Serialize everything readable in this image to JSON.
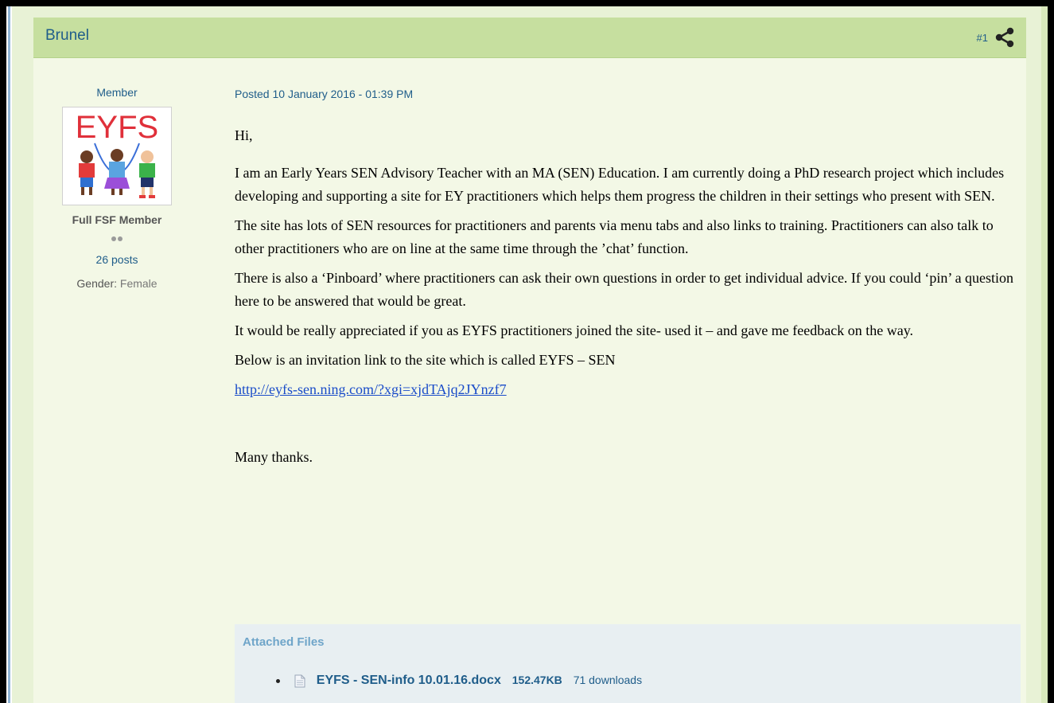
{
  "post": {
    "author": "Brunel",
    "number": "#1",
    "member_title": "Member",
    "avatar_text": "EYFS",
    "rank": "Full FSF Member",
    "post_count": "26 posts",
    "gender_label": "Gender:",
    "gender_value": "Female",
    "date": "Posted 10 January 2016 - 01:39 PM",
    "greeting": "Hi,",
    "paragraphs": [
      "I am an Early Years SEN Advisory Teacher with an MA (SEN) Education. I am currently doing a PhD research project which includes developing and supporting a site for EY practitioners which helps them progress the children in their settings who present with SEN.",
      "The site has lots of SEN resources for practitioners and parents via menu tabs and also links to training. Practitioners can also talk to other practitioners who are on line at the same time through the ’chat’ function.",
      "There is also a ‘Pinboard’ where practitioners can ask their own questions in order to get individual advice.  If you could ‘pin’ a question here to be answered that would be great.",
      "It would be really appreciated if you as EYFS practitioners joined the site- used it – and gave me feedback on the way.",
      "Below is an invitation link to the site which is called EYFS – SEN"
    ],
    "link": "http://eyfs-sen.ning.com/?xgi=xjdTAjq2JYnzf7",
    "closing": "Many thanks.",
    "attachments": {
      "title": "Attached Files",
      "files": [
        {
          "name": "EYFS - SEN-info 10.01.16.docx",
          "size": "152.47KB",
          "downloads": "71 downloads"
        }
      ]
    }
  },
  "icons": {
    "share": "share-icon",
    "document": "document-icon"
  },
  "colors": {
    "header_bg": "#c6df9f",
    "post_bg": "#f3f8e6",
    "link": "#1f5d8a"
  }
}
